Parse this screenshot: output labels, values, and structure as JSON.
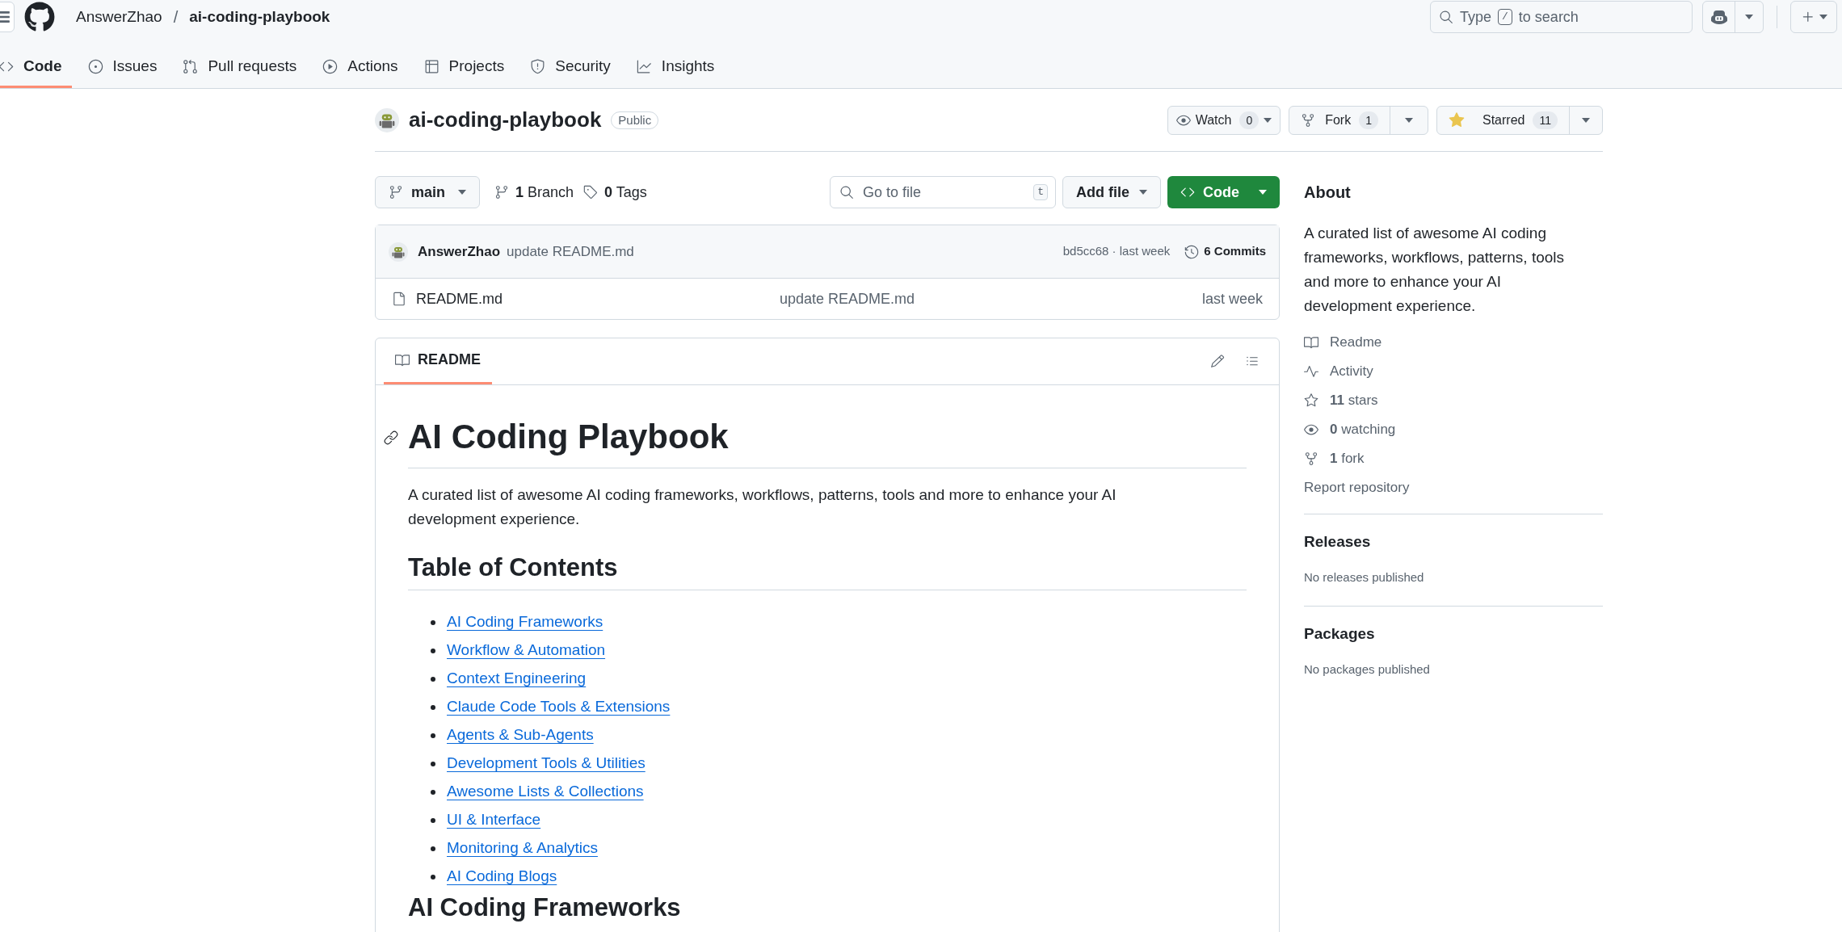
{
  "header": {
    "owner": "AnswerZhao",
    "separator": "/",
    "repo": "ai-coding-playbook",
    "search": {
      "before": "Type",
      "key": "/",
      "after": "to search"
    }
  },
  "nav_tabs": [
    {
      "label": "Code",
      "selected": true
    },
    {
      "label": "Issues",
      "selected": false
    },
    {
      "label": "Pull requests",
      "selected": false
    },
    {
      "label": "Actions",
      "selected": false
    },
    {
      "label": "Projects",
      "selected": false
    },
    {
      "label": "Security",
      "selected": false
    },
    {
      "label": "Insights",
      "selected": false
    }
  ],
  "repo": {
    "name": "ai-coding-playbook",
    "visibility": "Public",
    "watch": {
      "label": "Watch",
      "count": "0"
    },
    "fork": {
      "label": "Fork",
      "count": "1"
    },
    "star": {
      "label": "Starred",
      "count": "11",
      "starred": true
    }
  },
  "toolbar": {
    "branch": "main",
    "branches": "**1** Branch",
    "tags": "**0** Tags",
    "go_to_file": {
      "placeholder": "Go to file",
      "key": "t"
    },
    "add_file": "Add file",
    "code": "Code"
  },
  "latest_commit": {
    "author": "AnswerZhao",
    "message": "update README.md",
    "hash_time": "bd5cc68 · last week",
    "commits": "6 Commits"
  },
  "files": [
    {
      "name": "README.md",
      "message": "update README.md",
      "time": "last week"
    }
  ],
  "readme": {
    "tab": "README",
    "title": "AI Coding Playbook",
    "intro": "A curated list of awesome AI coding frameworks, workflows, patterns, tools and more to enhance your AI development experience.",
    "toc_heading": "Table of Contents",
    "toc": [
      "AI Coding Frameworks",
      "Workflow & Automation",
      "Context Engineering",
      "Claude Code Tools & Extensions",
      "Agents & Sub-Agents",
      "Development Tools & Utilities",
      "Awesome Lists & Collections",
      "UI & Interface",
      "Monitoring & Analytics",
      "AI Coding Blogs"
    ],
    "next_heading": "AI Coding Frameworks"
  },
  "about": {
    "heading": "About",
    "description": "A curated list of awesome AI coding frameworks, workflows, patterns, tools and more to enhance your AI development experience.",
    "links": [
      "Readme",
      "Activity",
      "**11** stars",
      "**0** watching",
      "**1** fork"
    ],
    "report": "Report repository"
  },
  "releases": {
    "heading": "Releases",
    "note": "No releases published"
  },
  "packages": {
    "heading": "Packages",
    "note": "No packages published"
  }
}
